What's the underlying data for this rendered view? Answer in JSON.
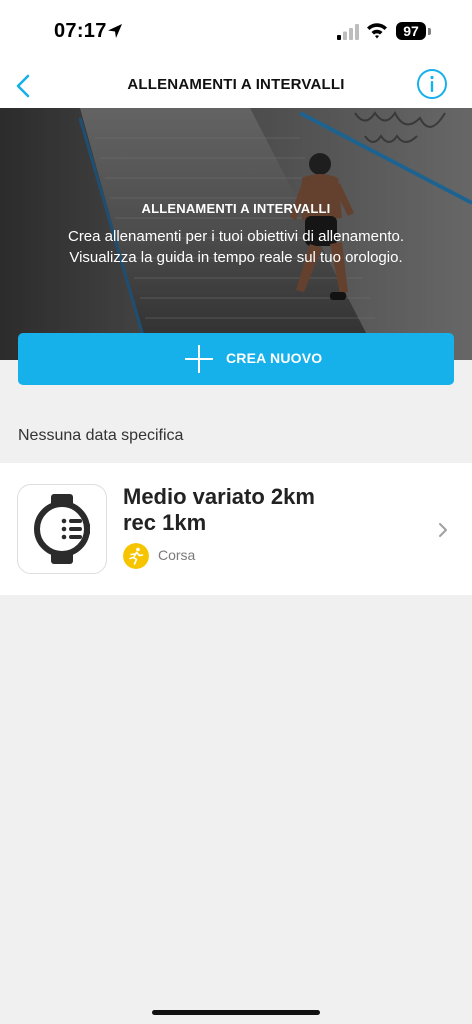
{
  "status_bar": {
    "time": "07:17",
    "battery": "97",
    "icons": [
      "location-arrow-icon",
      "cellular-signal-icon",
      "wifi-icon",
      "battery-icon"
    ]
  },
  "nav": {
    "title": "ALLENAMENTI A INTERVALLI",
    "back_icon": "chevron-left-icon",
    "info_icon": "info-icon",
    "accent_color": "#16b1ea"
  },
  "hero": {
    "title": "ALLENAMENTI A INTERVALLI",
    "subtitle_line1": "Crea allenamenti per i tuoi obiettivi di allenamento.",
    "subtitle_line2": "Visualizza la guida in tempo reale sul tuo orologio."
  },
  "create_button": {
    "label": "CREA NUOVO",
    "icon": "plus-icon",
    "color": "#16b1ea"
  },
  "section": {
    "label": "Nessuna data specifica"
  },
  "workouts": [
    {
      "title_line1": "Medio variato 2km",
      "title_line2": "rec 1km",
      "sport": "Corsa",
      "sport_icon": "running-icon",
      "sport_color": "#f7c500",
      "thumb_icon": "watch-intervals-icon"
    }
  ]
}
